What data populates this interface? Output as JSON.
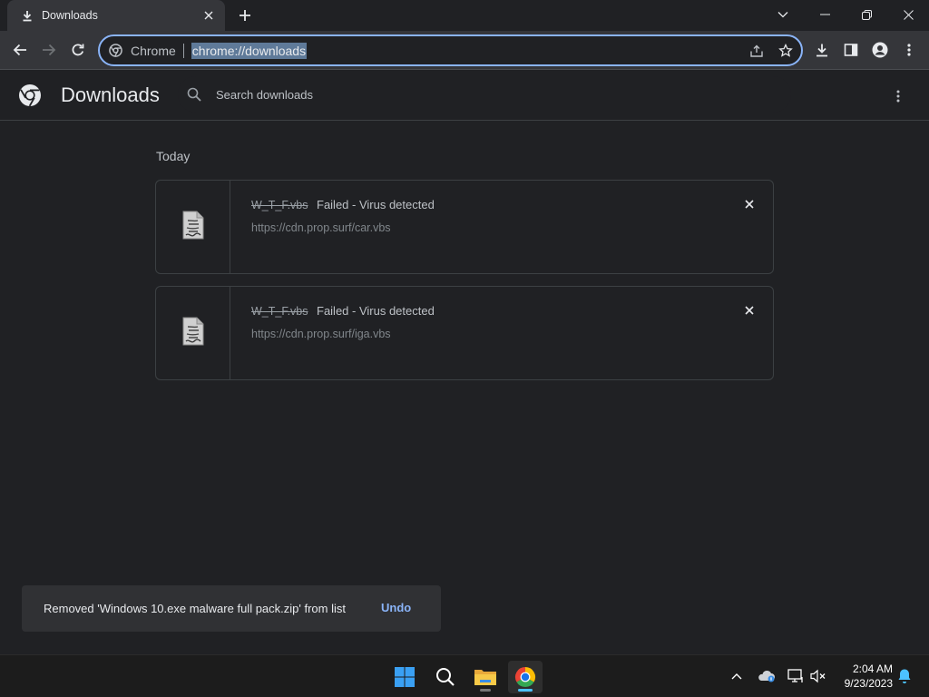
{
  "window": {
    "tab_title": "Downloads",
    "tab_icon": "download-icon",
    "controls": [
      "tab-search-icon",
      "minimize-icon",
      "restore-icon",
      "close-icon"
    ]
  },
  "toolbar": {
    "omnibox": {
      "site_chip": "Chrome",
      "url": "chrome://downloads"
    },
    "icons": [
      "back-icon",
      "forward-icon",
      "reload-icon",
      "share-icon",
      "bookmark-star-icon",
      "downloads-icon",
      "side-panel-icon",
      "profile-icon",
      "menu-icon"
    ]
  },
  "page": {
    "title": "Downloads",
    "search_placeholder": "Search downloads",
    "date_group": "Today",
    "items": [
      {
        "name": "W_T_F.vbs",
        "status": "Failed - Virus detected",
        "url": "https://cdn.prop.surf/car.vbs"
      },
      {
        "name": "W_T_F.vbs",
        "status": "Failed - Virus detected",
        "url": "https://cdn.prop.surf/iga.vbs"
      }
    ]
  },
  "toast": {
    "message": "Removed 'Windows 10.exe malware full pack.zip' from list",
    "action": "Undo"
  },
  "taskbar": {
    "apps": [
      "windows-start-icon",
      "search-icon",
      "file-explorer-icon",
      "chrome-icon"
    ],
    "active_app": "chrome-icon",
    "tray": [
      "chevron-up-icon",
      "onedrive-icon",
      "network-icon",
      "volume-mute-icon",
      "notification-bell-icon"
    ],
    "time": "2:04 AM",
    "date": "9/23/2023"
  },
  "colors": {
    "background": "#202124",
    "toolbar": "#35363a",
    "accent": "#8ab4f8",
    "taskbar": "#1c1c1c",
    "active_indicator": "#4cc2ff"
  }
}
